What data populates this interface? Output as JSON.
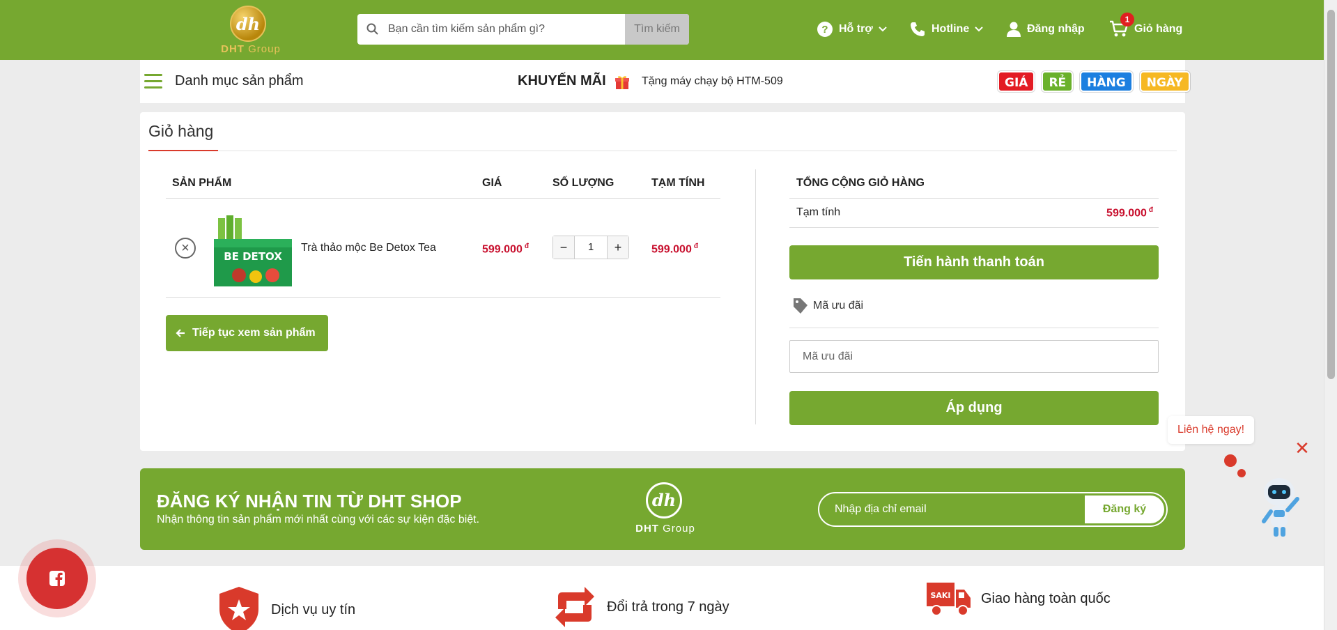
{
  "header": {
    "logo_text_a": "DHT",
    "logo_text_b": "Group",
    "logo_mark": "dh",
    "search_placeholder": "Bạn cần tìm kiếm sản phẩm gì?",
    "search_button": "Tìm kiếm",
    "support_label": "Hỗ trợ",
    "hotline_label": "Hotline",
    "login_label": "Đăng nhập",
    "cart_label": "Giỏ hàng",
    "cart_count": "1"
  },
  "catbar": {
    "category_label": "Danh mục sản phẩm",
    "promo_title": "KHUYẾN MÃI",
    "promo_text": "Tặng máy chạy bộ HTM-509",
    "tags": [
      "GIÁ",
      "RẺ",
      "HÀNG",
      "NGÀY"
    ]
  },
  "cart": {
    "title": "Giỏ hàng",
    "columns": {
      "product": "SẢN PHẨM",
      "price": "GIÁ",
      "quantity": "SỐ LƯỢNG",
      "subtotal": "TẠM TÍNH"
    },
    "items": [
      {
        "name": "Trà thảo mộc Be Detox Tea",
        "price": "599.000",
        "quantity": "1",
        "subtotal": "599.000",
        "currency": "đ",
        "image_label": "BE DETOX"
      }
    ],
    "continue_button": "Tiếp tục xem sản phẩm",
    "remove_glyph": "×",
    "minus_glyph": "−",
    "plus_glyph": "+"
  },
  "totals": {
    "title": "TỔNG CỘNG GIỎ HÀNG",
    "subtotal_label": "Tạm tính",
    "subtotal_value": "599.000",
    "currency": "đ",
    "checkout_button": "Tiến hành thanh toán",
    "coupon_heading": "Mã ưu đãi",
    "coupon_placeholder": "Mã ưu đãi",
    "apply_button": "Áp dụng"
  },
  "newsletter": {
    "title": "ĐĂNG KÝ NHẬN TIN TỪ DHT SHOP",
    "subtitle": "Nhận thông tin sản phẩm mới nhất cùng với các sự kiện đặc biệt.",
    "email_placeholder": "Nhập địa chỉ email",
    "subscribe_button": "Đăng ký",
    "logo_mark": "dh",
    "logo_text_a": "DHT",
    "logo_text_b": "Group"
  },
  "features": [
    {
      "label": "Dịch vụ uy tín",
      "icon": "shield-star-icon"
    },
    {
      "label": "Đổi trả trong 7 ngày",
      "icon": "exchange-icon"
    },
    {
      "label": "Giao hàng toàn quốc",
      "icon": "delivery-truck-icon",
      "badge": "SAKI"
    }
  ],
  "floating": {
    "contact_bubble": "Liên hệ ngay!",
    "close_glyph": "✕"
  },
  "colors": {
    "brand_green": "#76a830",
    "price_red": "#c8102e",
    "accent_red": "#d93a2b"
  }
}
